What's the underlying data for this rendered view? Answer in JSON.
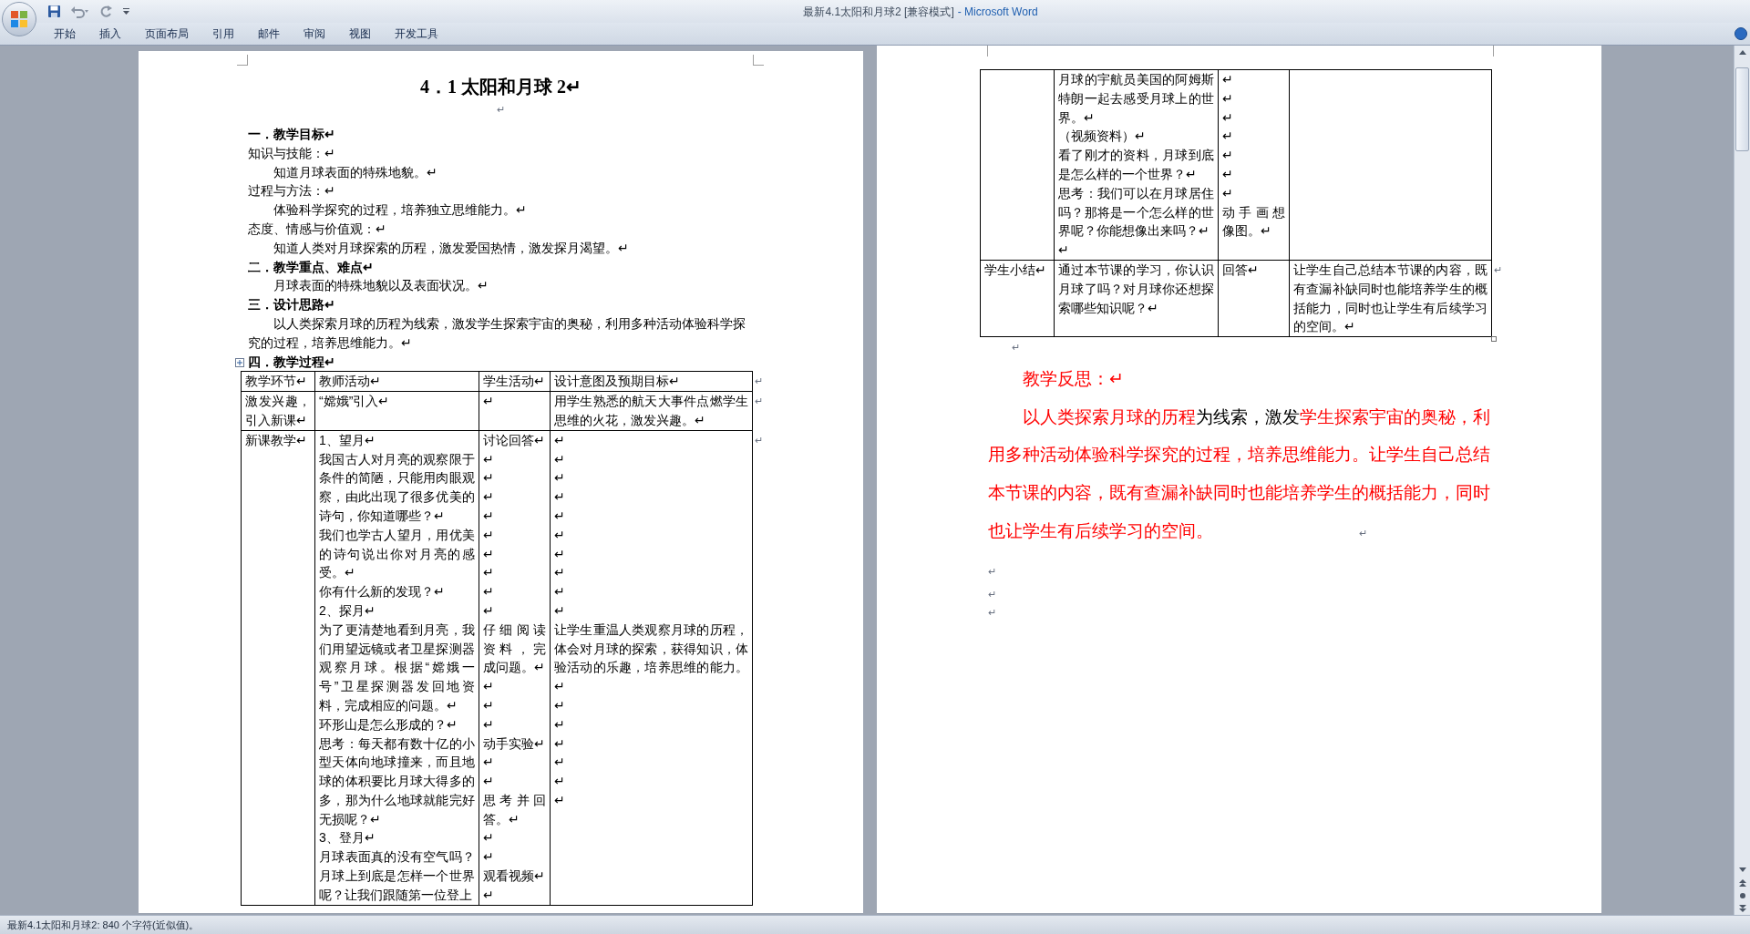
{
  "window": {
    "title": "最新4.1太阳和月球2 [兼容模式]",
    "app": "- Microsoft Word"
  },
  "ribbon_tabs": [
    {
      "label": "开始"
    },
    {
      "label": "插入"
    },
    {
      "label": "页面布局"
    },
    {
      "label": "引用"
    },
    {
      "label": "邮件"
    },
    {
      "label": "审阅"
    },
    {
      "label": "视图"
    },
    {
      "label": "开发工具"
    }
  ],
  "left_page": {
    "title": "4．1 太阳和月球 2↵",
    "title_mark": "↵",
    "blocks": [
      {
        "kind": "heading",
        "text": "一．教学目标↵"
      },
      {
        "kind": "label",
        "text": "知识与技能：↵"
      },
      {
        "kind": "body",
        "text": "知道月球表面的特殊地貌。↵"
      },
      {
        "kind": "label",
        "text": "过程与方法：↵"
      },
      {
        "kind": "body",
        "text": "体验科学探究的过程，培养独立思维能力。↵"
      },
      {
        "kind": "label",
        "text": "态度、情感与价值观：↵"
      },
      {
        "kind": "body",
        "text": "知道人类对月球探索的历程，激发爱国热情，激发探月渴望。↵"
      },
      {
        "kind": "heading",
        "text": "二．教学重点、难点↵"
      },
      {
        "kind": "body",
        "text": "月球表面的特殊地貌以及表面状况。↵"
      },
      {
        "kind": "heading",
        "text": "三．设计思路↵"
      },
      {
        "kind": "paragraph",
        "text": "以人类探索月球的历程为线索，激发学生探索宇宙的奥秘，利用多种活动体验科学探究的过程，培养思维能力。↵"
      },
      {
        "kind": "heading",
        "text": "四．教学过程↵"
      }
    ],
    "table": {
      "rows": [
        {
          "end": "↵",
          "cells": [
            {
              "paragraphs": [
                "教学环节↵"
              ]
            },
            {
              "paragraphs": [
                "教师活动↵"
              ]
            },
            {
              "paragraphs": [
                "学生活动↵"
              ]
            },
            {
              "paragraphs": [
                "设计意图及预期目标↵"
              ]
            }
          ]
        },
        {
          "end": "↵",
          "cells": [
            {
              "paragraphs": [
                "激发兴趣，引入新课↵"
              ]
            },
            {
              "paragraphs": [
                "“嫦娥”引入↵"
              ]
            },
            {
              "paragraphs": [
                "↵"
              ]
            },
            {
              "paragraphs": [
                "用学生熟悉的航天大事件点燃学生思维的火花，激发兴趣。↵"
              ]
            }
          ]
        },
        {
          "end": "↵",
          "cells": [
            {
              "paragraphs": [
                "新课教学↵"
              ]
            },
            {
              "paragraphs": [
                "1、望月↵",
                "我国古人对月亮的观察限于条件的简陋，只能用肉眼观察，由此出现了很多优美的诗句，你知道哪些？↵",
                "我们也学古人望月，用优美的诗句说出你对月亮的感受。↵",
                "你有什么新的发现？↵",
                "2、探月↵",
                "为了更清楚地看到月亮，我们用望远镜或者卫星探测器观察月球。根据“嫦娥一号”卫星探测器发回地资料，完成相应的问题。↵",
                "环形山是怎么形成的？↵",
                "思考：每天都有数十亿的小型天体向地球撞来，而且地球的体积要比月球大得多的多，那为什么地球就能完好无损呢？↵",
                "3、登月↵",
                "月球表面真的没有空气吗？月球上到底是怎样一个世界呢？让我们跟随第一位登上"
              ]
            },
            {
              "paragraphs": [
                "讨论回答↵",
                "↵",
                "↵",
                "↵",
                "↵",
                "↵",
                "↵",
                "↵",
                "↵",
                "↵",
                "仔细阅读资料，完成问题。↵",
                "↵",
                "↵",
                "↵",
                "动手实验↵",
                "↵",
                "↵",
                "思考并回答。↵",
                "↵",
                "↵",
                "观看视频↵",
                "↵"
              ]
            },
            {
              "paragraphs": [
                "↵",
                "↵",
                "↵",
                "↵",
                "↵",
                "↵",
                "↵",
                "↵",
                "↵",
                "↵",
                "让学生重温人类观察月球的历程，体会对月球的探索，获得知识，体验活动的乐趣，培养思维的能力。↵",
                "↵",
                "↵",
                "↵",
                "↵",
                "↵",
                "↵"
              ]
            }
          ]
        }
      ]
    }
  },
  "right_page": {
    "table": {
      "rows": [
        {
          "cells": [
            {},
            {
              "paragraphs": [
                "月球的宇航员美国的阿姆斯特朗一起去感受月球上的世界。↵",
                "（视频资料）↵",
                "看了刚才的资料，月球到底是怎么样的一个世界？↵",
                "思考：我们可以在月球居住吗？那将是一个怎么样的世界呢？你能想像出来吗？↵",
                "↵"
              ]
            },
            {
              "paragraphs": [
                "↵",
                "↵",
                "↵",
                "↵",
                "↵",
                "↵",
                "↵",
                "动手画想像图。↵"
              ]
            },
            {}
          ]
        },
        {
          "end": "↵",
          "cells": [
            {
              "paragraphs": [
                "学生小结↵"
              ]
            },
            {
              "paragraphs": [
                "通过本节课的学习，你认识月球了吗？对月球你还想探索哪些知识呢？↵"
              ]
            },
            {
              "paragraphs": [
                "回答↵"
              ]
            },
            {
              "paragraphs": [
                "让学生自己总结本节课的内容，既有查漏补缺同时也能培养学生的概括能力，同时也让学生有后续学习的空间。↵"
              ]
            }
          ]
        }
      ]
    },
    "after_table_mark": "↵",
    "reflection": {
      "heading": "教学反思：↵",
      "segments": [
        {
          "text": "以人类探索月球的历程",
          "color": "#ff0000"
        },
        {
          "text": "为线索，激发",
          "color": "#000000"
        },
        {
          "text": "学生探索宇宙的奥秘，利用多种活动体验科学探究的过程，培养思维能力。让学生自己总结本节课的内容，既有查漏补缺同时也能培养学生的概括能力，同时也让学生有后续学习的空间。",
          "color": "#ff0000"
        }
      ],
      "end_mark": "↵"
    },
    "trailing_marks": [
      "↵",
      "↵",
      "↵"
    ]
  },
  "status_bar": "最新4.1太阳和月球2: 840 个字符(近似值)。"
}
